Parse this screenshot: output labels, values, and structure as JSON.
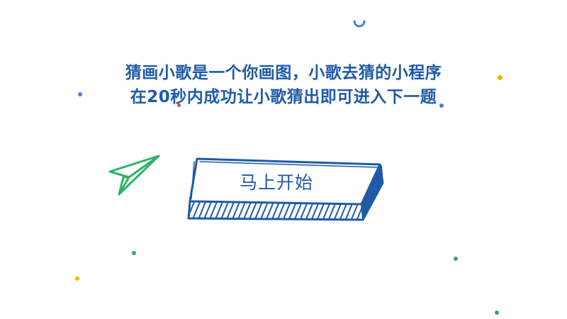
{
  "intro": {
    "line1": "猜画小歌是一个你画图，小歌去猜的小程序",
    "line2": "在20秒内成功让小歌猜出即可进入下一题"
  },
  "start_button": {
    "label": "马上开始"
  },
  "icons": {
    "plane": "paper-plane-icon",
    "spinner": "loading-spinner-icon"
  },
  "colors": {
    "text_blue": "#1f5aa8",
    "button_blue": "#1f5aa8",
    "plane_green": "#2db36a",
    "dot_yellow": "#f4b400",
    "dot_green": "#3aa85c",
    "dot_blue": "#4a7fd6",
    "dot_red": "#e04a3c"
  }
}
